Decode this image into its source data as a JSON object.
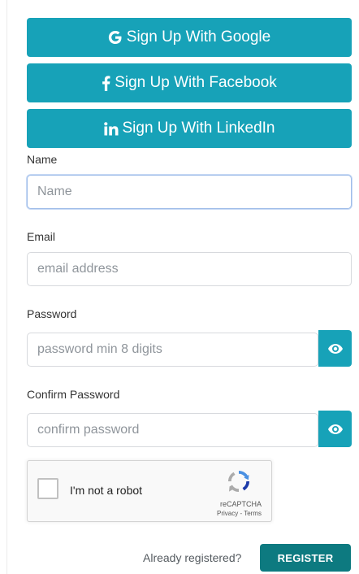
{
  "social": {
    "google": {
      "label": "Sign Up With Google",
      "icon": "google-icon"
    },
    "facebook": {
      "label": "Sign Up With Facebook",
      "icon": "facebook-icon"
    },
    "linkedin": {
      "label": "Sign Up With LinkedIn",
      "icon": "linkedin-icon"
    }
  },
  "form": {
    "name": {
      "label": "Name",
      "placeholder": "Name",
      "value": ""
    },
    "email": {
      "label": "Email",
      "placeholder": "email address",
      "value": ""
    },
    "password": {
      "label": "Password",
      "placeholder": "password min 8 digits",
      "value": ""
    },
    "confirm_password": {
      "label": "Confirm Password",
      "placeholder": "confirm password",
      "value": ""
    }
  },
  "captcha": {
    "label": "I'm not a robot",
    "brand": "reCAPTCHA",
    "links": "Privacy - Terms"
  },
  "footer": {
    "already_registered": "Already registered?",
    "register_label": "REGISTER"
  },
  "colors": {
    "accent": "#17a2b8",
    "register": "#0d7a80"
  }
}
